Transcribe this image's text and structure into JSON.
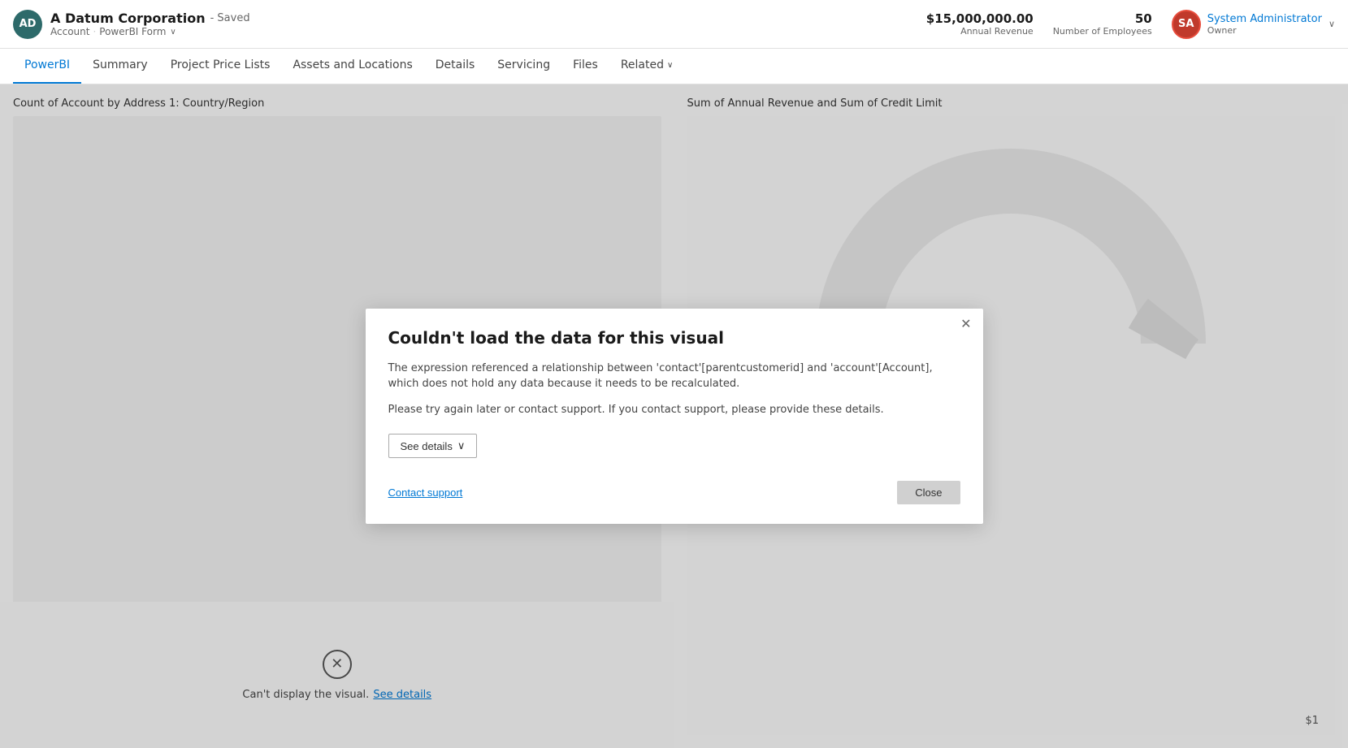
{
  "header": {
    "avatar_ad": "AD",
    "company_name": "A Datum Corporation",
    "saved_label": "- Saved",
    "breadcrumb_account": "Account",
    "breadcrumb_sep": "·",
    "breadcrumb_form": "PowerBI Form",
    "annual_revenue_value": "$15,000,000.00",
    "annual_revenue_label": "Annual Revenue",
    "employees_value": "50",
    "employees_label": "Number of Employees",
    "avatar_sa": "SA",
    "user_name": "System Administrator",
    "user_role": "Owner",
    "chevron": "∨"
  },
  "nav": {
    "items": [
      {
        "id": "powerbi",
        "label": "PowerBI",
        "active": true
      },
      {
        "id": "summary",
        "label": "Summary",
        "active": false
      },
      {
        "id": "project-price-lists",
        "label": "Project Price Lists",
        "active": false
      },
      {
        "id": "assets-and-locations",
        "label": "Assets and Locations",
        "active": false
      },
      {
        "id": "details",
        "label": "Details",
        "active": false
      },
      {
        "id": "servicing",
        "label": "Servicing",
        "active": false
      },
      {
        "id": "files",
        "label": "Files",
        "active": false
      },
      {
        "id": "related",
        "label": "Related",
        "active": false,
        "has_chevron": true
      }
    ]
  },
  "main": {
    "left_chart_title": "Count of Account by Address 1: Country/Region",
    "right_chart_title": "Sum of Annual Revenue and Sum of Credit Limit",
    "chart_dollar_label": "$1",
    "bottom_error_text": "Can't display the visual.",
    "bottom_error_link": "See details"
  },
  "modal": {
    "title": "Couldn't load the data for this visual",
    "body1": "The expression referenced a relationship between 'contact'[parentcustomerid] and 'account'[Account], which does not hold any data because it needs to be recalculated.",
    "body2": "Please try again later or contact support. If you contact support, please provide these details.",
    "see_details_label": "See details",
    "see_details_chevron": "∨",
    "contact_support_label": "Contact support",
    "close_label": "Close"
  }
}
